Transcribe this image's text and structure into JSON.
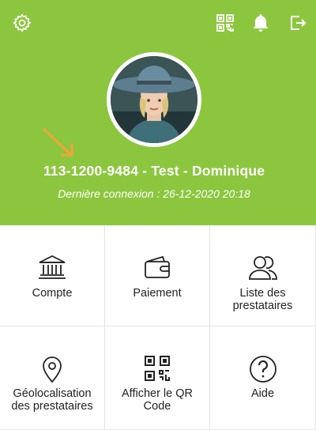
{
  "header": {
    "background_color": "#8cc63f",
    "icons": [
      "gear-icon",
      "qr-code-icon",
      "bell-icon",
      "logout-icon"
    ]
  },
  "profile": {
    "user_line": "113-1200-9484 - Test - Dominique",
    "last_login": "Dernière connexion : 26-12-2020 20:18"
  },
  "menu": {
    "tiles": [
      {
        "icon": "bank-icon",
        "line1": "Compte",
        "line2": ""
      },
      {
        "icon": "wallet-icon",
        "line1": "Paiement",
        "line2": ""
      },
      {
        "icon": "users-icon",
        "line1": "Liste des",
        "line2": "prestataires"
      },
      {
        "icon": "location-pin-icon",
        "line1": "Géolocalisation",
        "line2": "des prestataires"
      },
      {
        "icon": "qr-code-icon",
        "line1": "Afficher le QR",
        "line2": "Code"
      },
      {
        "icon": "help-icon",
        "line1": "Aide",
        "line2": ""
      }
    ]
  }
}
